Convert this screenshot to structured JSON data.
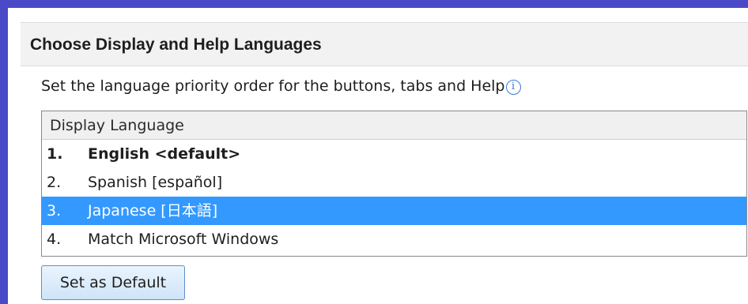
{
  "section": {
    "title": "Choose Display and Help Languages"
  },
  "instruction": {
    "text": "Set the language priority order for the buttons, tabs and Help",
    "info_glyph": "i",
    "info_icon": "info-circle-icon"
  },
  "language_list": {
    "header": "Display Language",
    "items": [
      {
        "number": "1.",
        "name": "English <default>"
      },
      {
        "number": "2.",
        "name": "Spanish [español]"
      },
      {
        "number": "3.",
        "name": "Japanese [日本語]"
      },
      {
        "number": "4.",
        "name": "Match Microsoft Windows"
      }
    ],
    "selected_index": 2,
    "default_index": 0
  },
  "buttons": {
    "set_default_label": "Set as Default"
  },
  "colors": {
    "selection": "#3399ff",
    "window_border": "#4a4ac8",
    "header_background": "#f2f2f2"
  }
}
